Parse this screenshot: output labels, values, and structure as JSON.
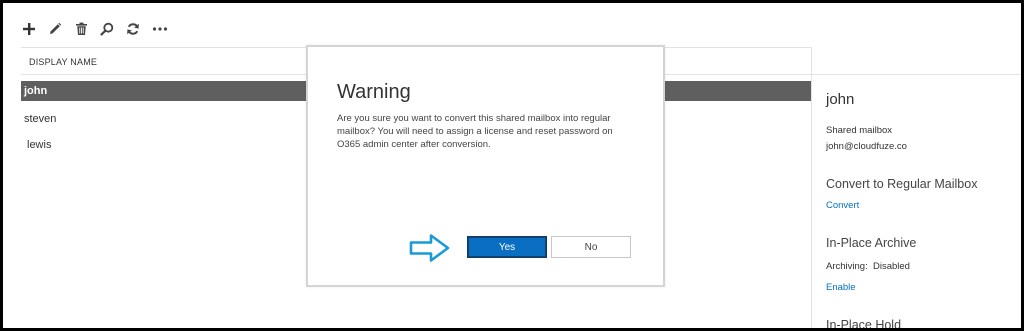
{
  "toolbar": {
    "icons": [
      "plus-icon",
      "pencil-icon",
      "trash-icon",
      "search-icon",
      "refresh-icon",
      "more-icon"
    ],
    "more_label": "..."
  },
  "list": {
    "column_header": "DISPLAY NAME",
    "rows": [
      "john",
      "steven",
      "lewis"
    ],
    "selected": "john"
  },
  "details": {
    "name": "john",
    "type": "Shared mailbox",
    "email": "john@cloudfuze.co",
    "convert_heading": "Convert to Regular Mailbox",
    "convert_link": "Convert",
    "archive_heading": "In-Place Archive",
    "archiving_status": "Archiving:  Disabled",
    "enable_link": "Enable",
    "hold_heading": "In-Place Hold"
  },
  "dialog": {
    "title": "Warning",
    "message": "Are you sure you want to convert this shared mailbox into regular mailbox? You will need to assign a license and reset password on O365 admin center after conversion.",
    "yes_label": "Yes",
    "no_label": "No"
  },
  "colors": {
    "accent": "#0072c6",
    "selected_row": "#5f5f5f",
    "arrow": "#1a9ad6"
  }
}
